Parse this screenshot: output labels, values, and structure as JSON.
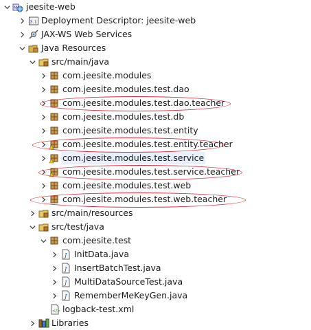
{
  "tree": {
    "project": "jeesite-web",
    "deployment_descriptor": "Deployment Descriptor: jeesite-web",
    "jaxws": "JAX-WS Web Services",
    "java_resources": "Java Resources",
    "src_main_java": "src/main/java",
    "packages": [
      "com.jeesite.modules",
      "com.jeesite.modules.test.dao",
      "com.jeesite.modules.test.dao.teacher",
      "com.jeesite.modules.test.db",
      "com.jeesite.modules.test.entity",
      "com.jeesite.modules.test.entity.teacher",
      "com.jeesite.modules.test.service",
      "com.jeesite.modules.test.service.teacher",
      "com.jeesite.modules.test.web",
      "com.jeesite.modules.test.web.teacher"
    ],
    "src_main_resources": "src/main/resources",
    "src_test_java": "src/test/java",
    "test_package": "com.jeesite.test",
    "test_files": [
      "InitData.java",
      "InsertBatchTest.java",
      "MultiDataSourceTest.java",
      "RememberMeKeyGen.java"
    ],
    "logback": "logback-test.xml",
    "libraries": "Libraries"
  },
  "colors": {
    "highlight_oval": "#e0283a",
    "selection": "#e8f1fb"
  },
  "icons": {
    "project": "web-project-icon",
    "descriptor": "deployment-descriptor-icon",
    "jaxws": "web-services-icon",
    "java_resources": "java-resources-icon",
    "source_folder": "source-folder-icon",
    "package": "package-icon",
    "java_file": "java-file-icon",
    "xml_file": "xml-file-icon",
    "libraries": "libraries-icon"
  }
}
